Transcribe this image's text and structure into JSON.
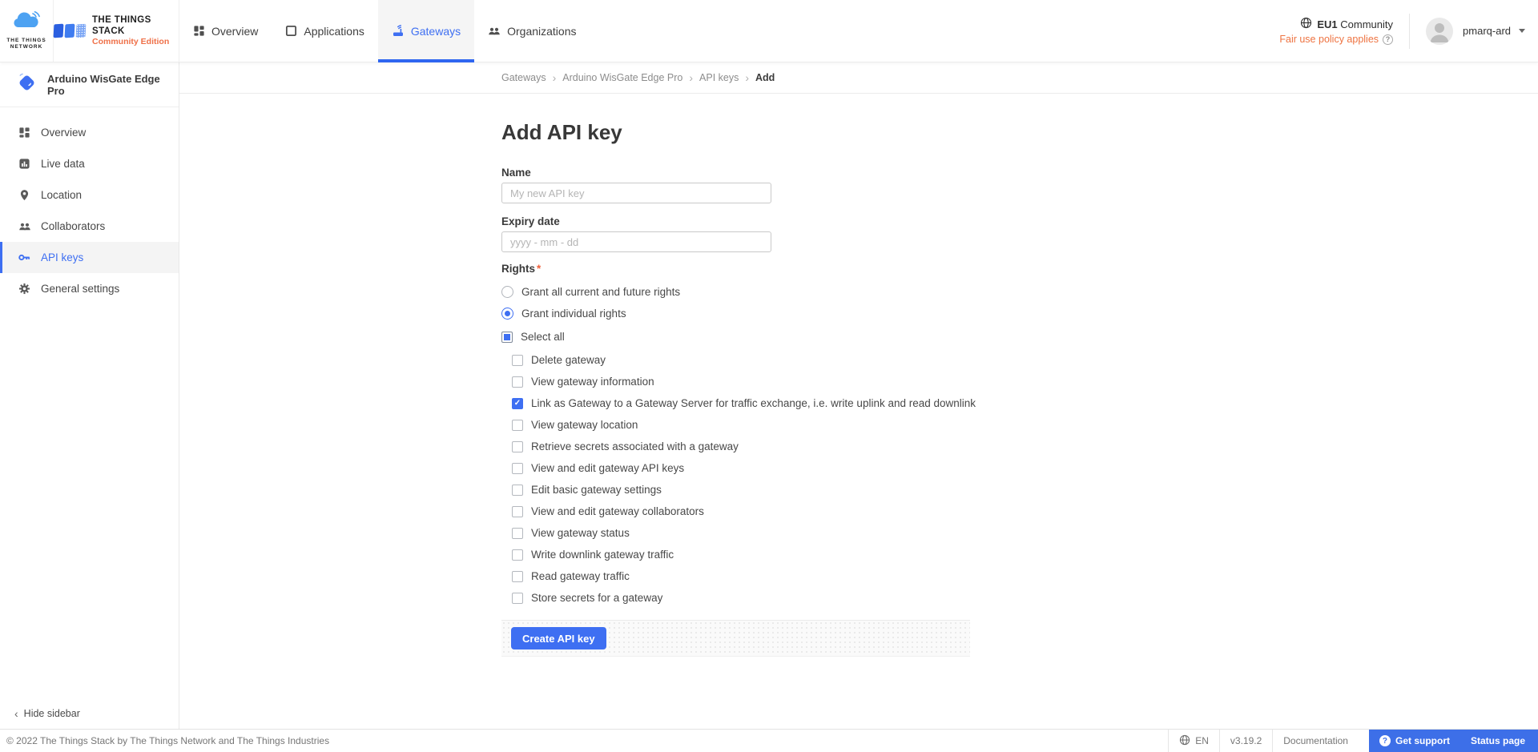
{
  "colors": {
    "accent": "#3e6ff2",
    "tab_underline": "#2f66f0",
    "orange": "#ef7048",
    "footer_blue": "#3d6fe8",
    "required_red": "#f0613c"
  },
  "header": {
    "ttn_logo_line1": "THE THINGS",
    "ttn_logo_line2": "NETWORK",
    "stack_name": "THE THINGS STACK",
    "stack_edition": "Community Edition",
    "nav": [
      {
        "label": "Overview",
        "icon": "overview-grid-icon",
        "active": false
      },
      {
        "label": "Applications",
        "icon": "application-box-icon",
        "active": false
      },
      {
        "label": "Gateways",
        "icon": "gateway-router-icon",
        "active": true
      },
      {
        "label": "Organizations",
        "icon": "people-icon",
        "active": false
      }
    ],
    "region_bold": "EU1",
    "region_rest": "Community",
    "fair_use": "Fair use policy applies",
    "user_name": "pmarq-ard"
  },
  "sidebar": {
    "entity_name": "Arduino WisGate Edge Pro",
    "items": [
      {
        "label": "Overview",
        "icon": "overview-grid-icon",
        "active": false
      },
      {
        "label": "Live data",
        "icon": "live-data-chart-icon",
        "active": false
      },
      {
        "label": "Location",
        "icon": "location-pin-icon",
        "active": false
      },
      {
        "label": "Collaborators",
        "icon": "people-icon",
        "active": false
      },
      {
        "label": "API keys",
        "icon": "key-icon",
        "active": true
      },
      {
        "label": "General settings",
        "icon": "gear-icon",
        "active": false
      }
    ],
    "hide_label": "Hide sidebar"
  },
  "breadcrumb": {
    "items": [
      "Gateways",
      "Arduino WisGate Edge Pro",
      "API keys",
      "Add"
    ]
  },
  "form": {
    "title": "Add API key",
    "name_label": "Name",
    "name_placeholder": "My new API key",
    "name_value": "",
    "expiry_label": "Expiry date",
    "expiry_placeholder": "yyyy - mm - dd",
    "expiry_value": "",
    "rights_label": "Rights",
    "required_mark": "*",
    "grant_options": [
      {
        "label": "Grant all current and future rights",
        "checked": false
      },
      {
        "label": "Grant individual rights",
        "checked": true
      }
    ],
    "select_all": {
      "label": "Select all",
      "state": "mixed"
    },
    "rights": [
      {
        "label": "Delete gateway",
        "checked": false
      },
      {
        "label": "View gateway information",
        "checked": false
      },
      {
        "label": "Link as Gateway to a Gateway Server for traffic exchange, i.e. write uplink and read downlink",
        "checked": true
      },
      {
        "label": "View gateway location",
        "checked": false
      },
      {
        "label": "Retrieve secrets associated with a gateway",
        "checked": false
      },
      {
        "label": "View and edit gateway API keys",
        "checked": false
      },
      {
        "label": "Edit basic gateway settings",
        "checked": false
      },
      {
        "label": "View and edit gateway collaborators",
        "checked": false
      },
      {
        "label": "View gateway status",
        "checked": false
      },
      {
        "label": "Write downlink gateway traffic",
        "checked": false
      },
      {
        "label": "Read gateway traffic",
        "checked": false
      },
      {
        "label": "Store secrets for a gateway",
        "checked": false
      }
    ],
    "submit_label": "Create API key"
  },
  "footer": {
    "copyright": "© 2022 The Things Stack by The Things Network and The Things Industries",
    "language": "EN",
    "version": "v3.19.2",
    "documentation": "Documentation",
    "get_support": "Get support",
    "status_page": "Status page"
  }
}
